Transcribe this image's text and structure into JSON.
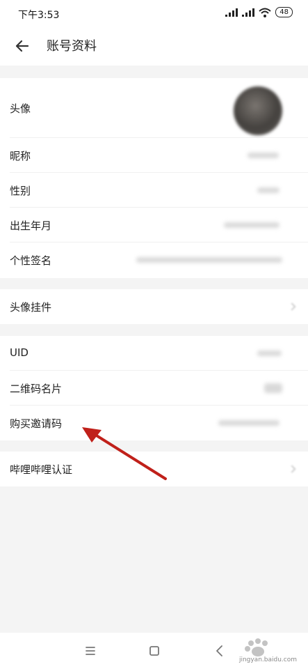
{
  "status_bar": {
    "time": "下午3:53",
    "battery": "48"
  },
  "header": {
    "title": "账号资料"
  },
  "rows": {
    "avatar": "头像",
    "nickname": "昵称",
    "gender": "性别",
    "birthday": "出生年月",
    "signature": "个性签名",
    "avatar_pendant": "头像挂件",
    "uid": "UID",
    "qr_card": "二维码名片",
    "invite_code": "购买邀请码",
    "certification": "哔哩哔哩认证"
  },
  "watermark": {
    "site": "jingyan.baidu.com"
  },
  "colors": {
    "annotation_arrow": "#c0201a",
    "background": "#f4f4f4"
  },
  "icons": {
    "back": "arrow-left-icon",
    "menu": "menu-icon",
    "home": "home-icon",
    "nav_back": "chevron-left-icon"
  }
}
